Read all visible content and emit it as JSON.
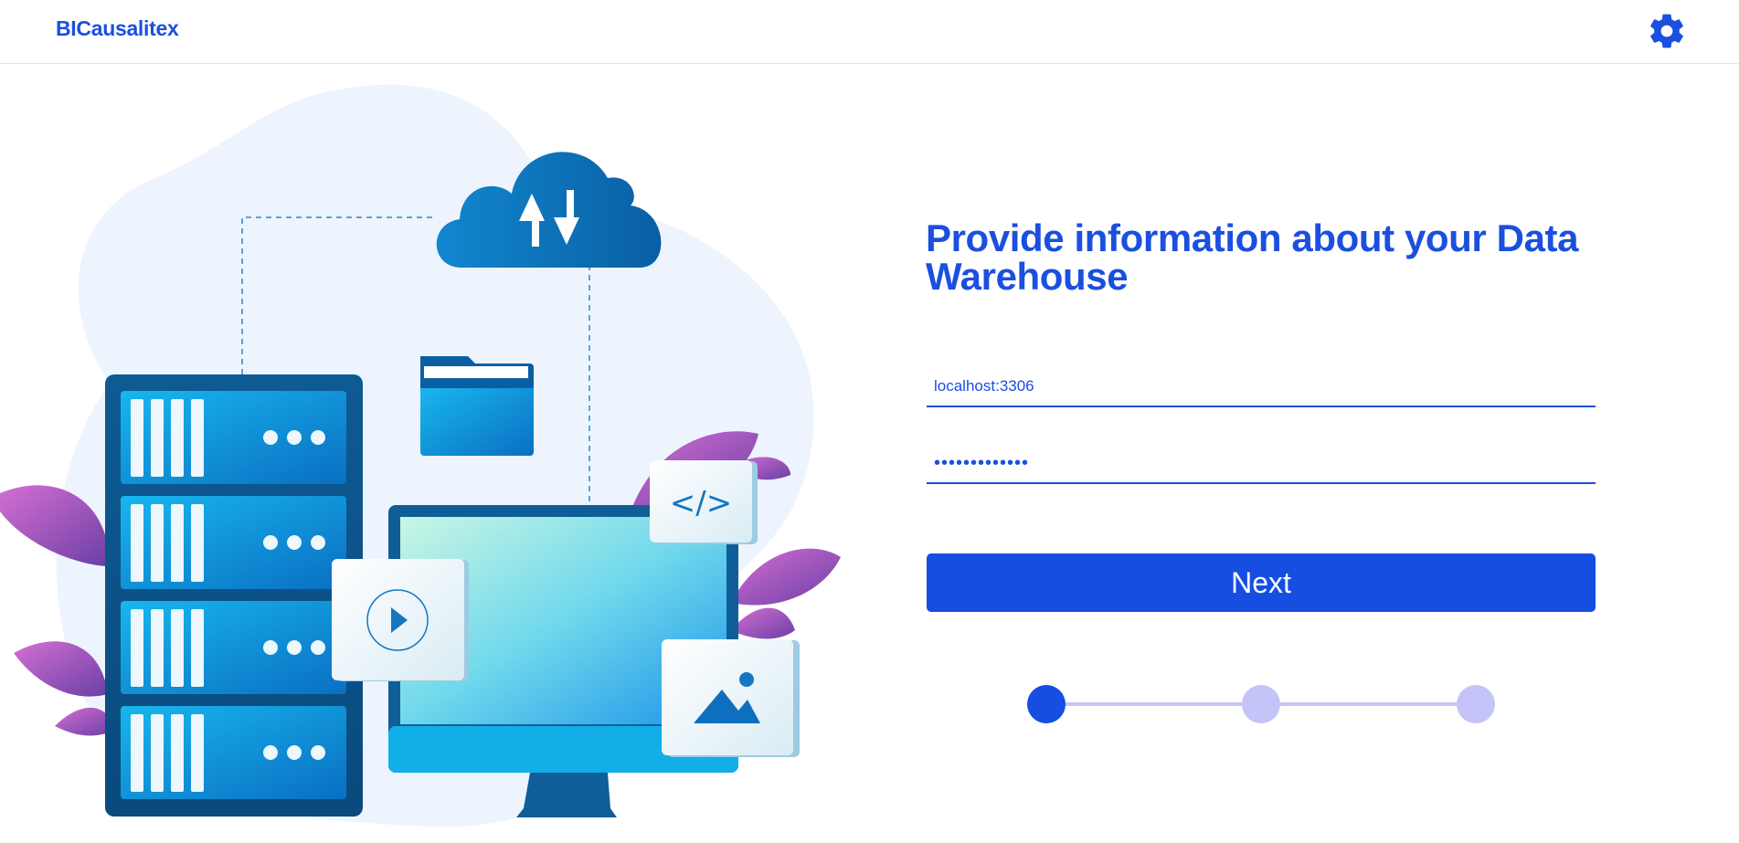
{
  "app": {
    "brand": "BICausalitex"
  },
  "header": {
    "settings_icon": "gear-icon"
  },
  "main": {
    "title": "Provide information about your Data Warehouse",
    "host_field": {
      "value": "localhost:3306",
      "placeholder": "localhost:3306"
    },
    "password_field": {
      "value": "•••••••••••••",
      "type": "password"
    },
    "next_label": "Next"
  },
  "stepper": {
    "current_step": 1,
    "total_steps": 3
  },
  "colors": {
    "accent": "#164ee2",
    "step_inactive": "#c4c4f8",
    "illustration_blue": "#0a8fd6",
    "leaf_purple": "#b066cc"
  },
  "illustration": {
    "code_tag_text": "</>"
  }
}
